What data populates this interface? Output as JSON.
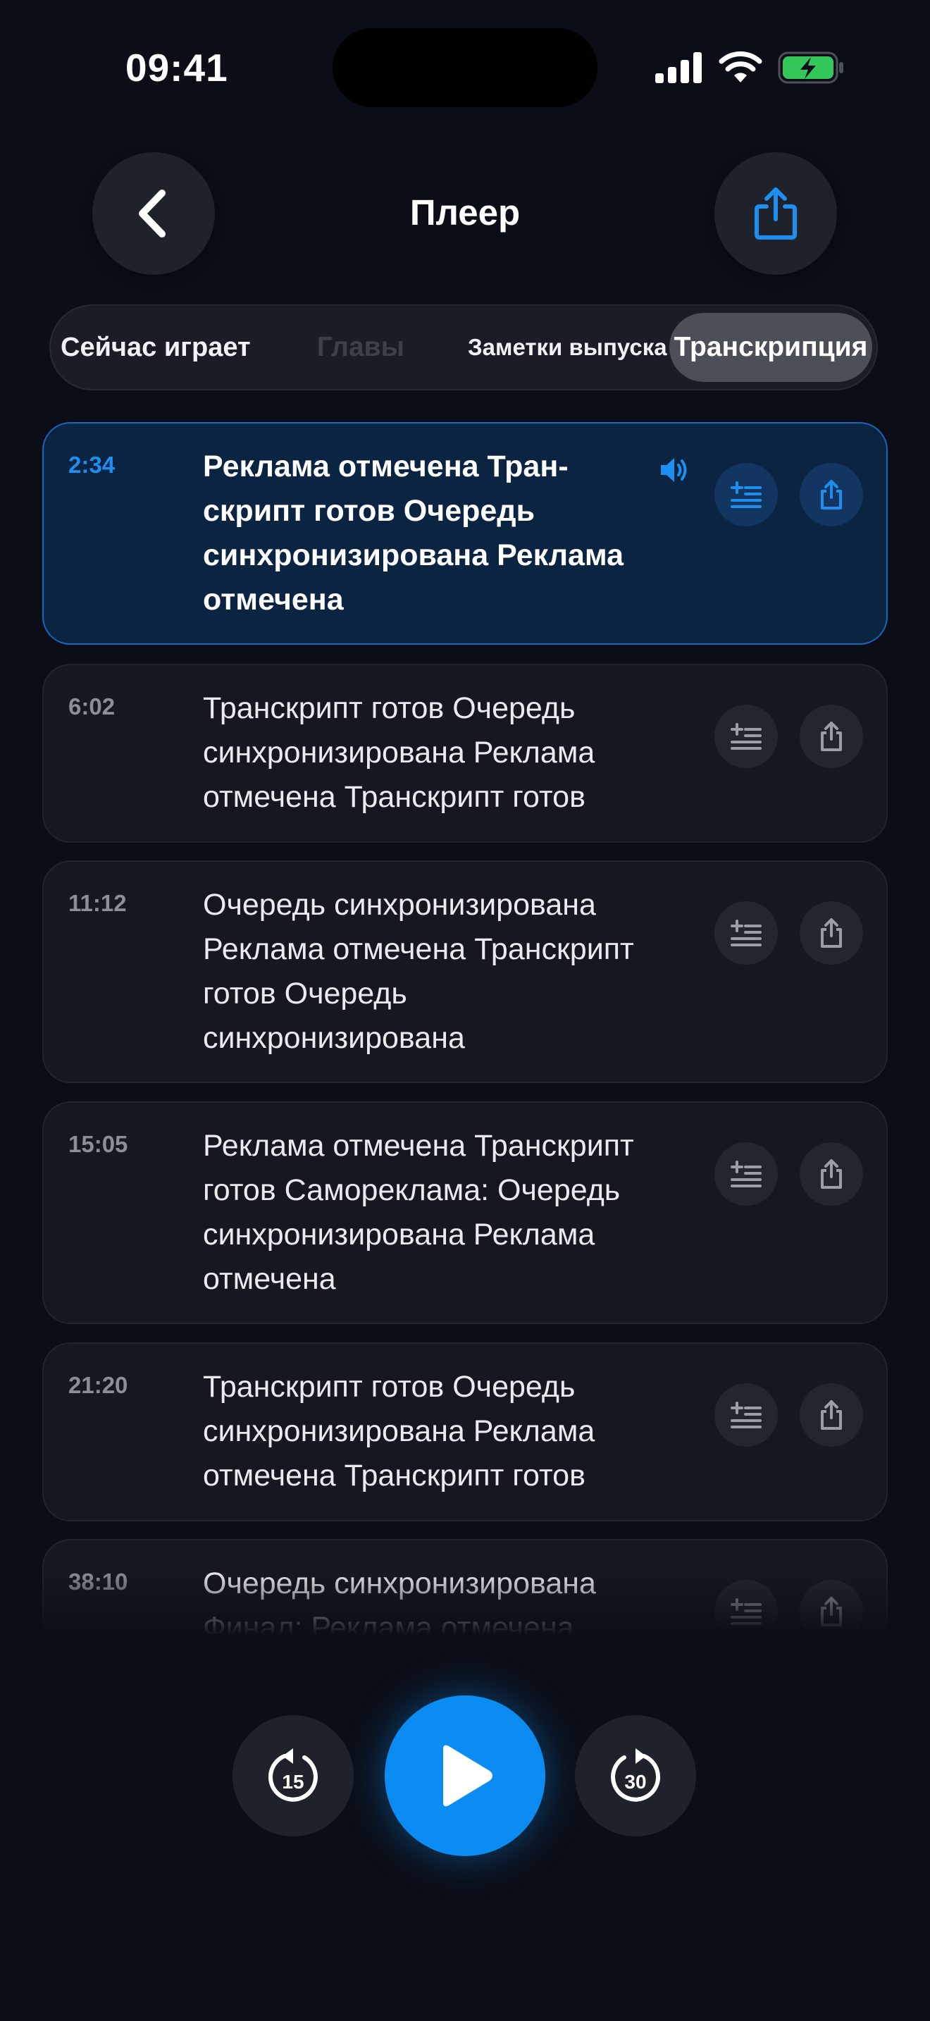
{
  "status_bar": {
    "time": "09:41"
  },
  "header": {
    "title": "Плеер"
  },
  "tabs": [
    {
      "label": "Сейчас играет"
    },
    {
      "label": "Главы"
    },
    {
      "label": "Заметки выпуска"
    },
    {
      "label": "Транскрипция",
      "selected": true
    }
  ],
  "segments": [
    {
      "time": "2:34",
      "text": "Реклама отмечена Тран­скрипт готов Очередь синхронизирована Реклама отмечена",
      "active": true
    },
    {
      "time": "6:02",
      "text": "Транскрипт готов Очередь синхронизирована Реклама отмечена Транскрипт готов"
    },
    {
      "time": "11:12",
      "text": "Очередь синхронизиро­вана Реклама отмечена Транскрипт готов Очередь синхронизирована"
    },
    {
      "time": "15:05",
      "text": "Реклама отмечена Тран­скрипт готов Самореклама: Очередь синхронизирована Реклама отмечена"
    },
    {
      "time": "21:20",
      "text": "Транскрипт готов Очередь синхронизирована Реклама отмечена Транскрипт готов"
    },
    {
      "time": "38:10",
      "text": "Очередь синхронизирована Финал: Реклама отмечена"
    }
  ],
  "controls": {
    "skip_back": "15",
    "skip_forward": "30"
  },
  "colors": {
    "accent": "#0b8cf2",
    "background": "#0b0e17",
    "battery": "#34c759"
  },
  "icons": [
    "back-chevron-icon",
    "share-icon",
    "speaker-icon",
    "add-note-icon",
    "skip-back-15-icon",
    "play-icon",
    "skip-forward-30-icon"
  ]
}
